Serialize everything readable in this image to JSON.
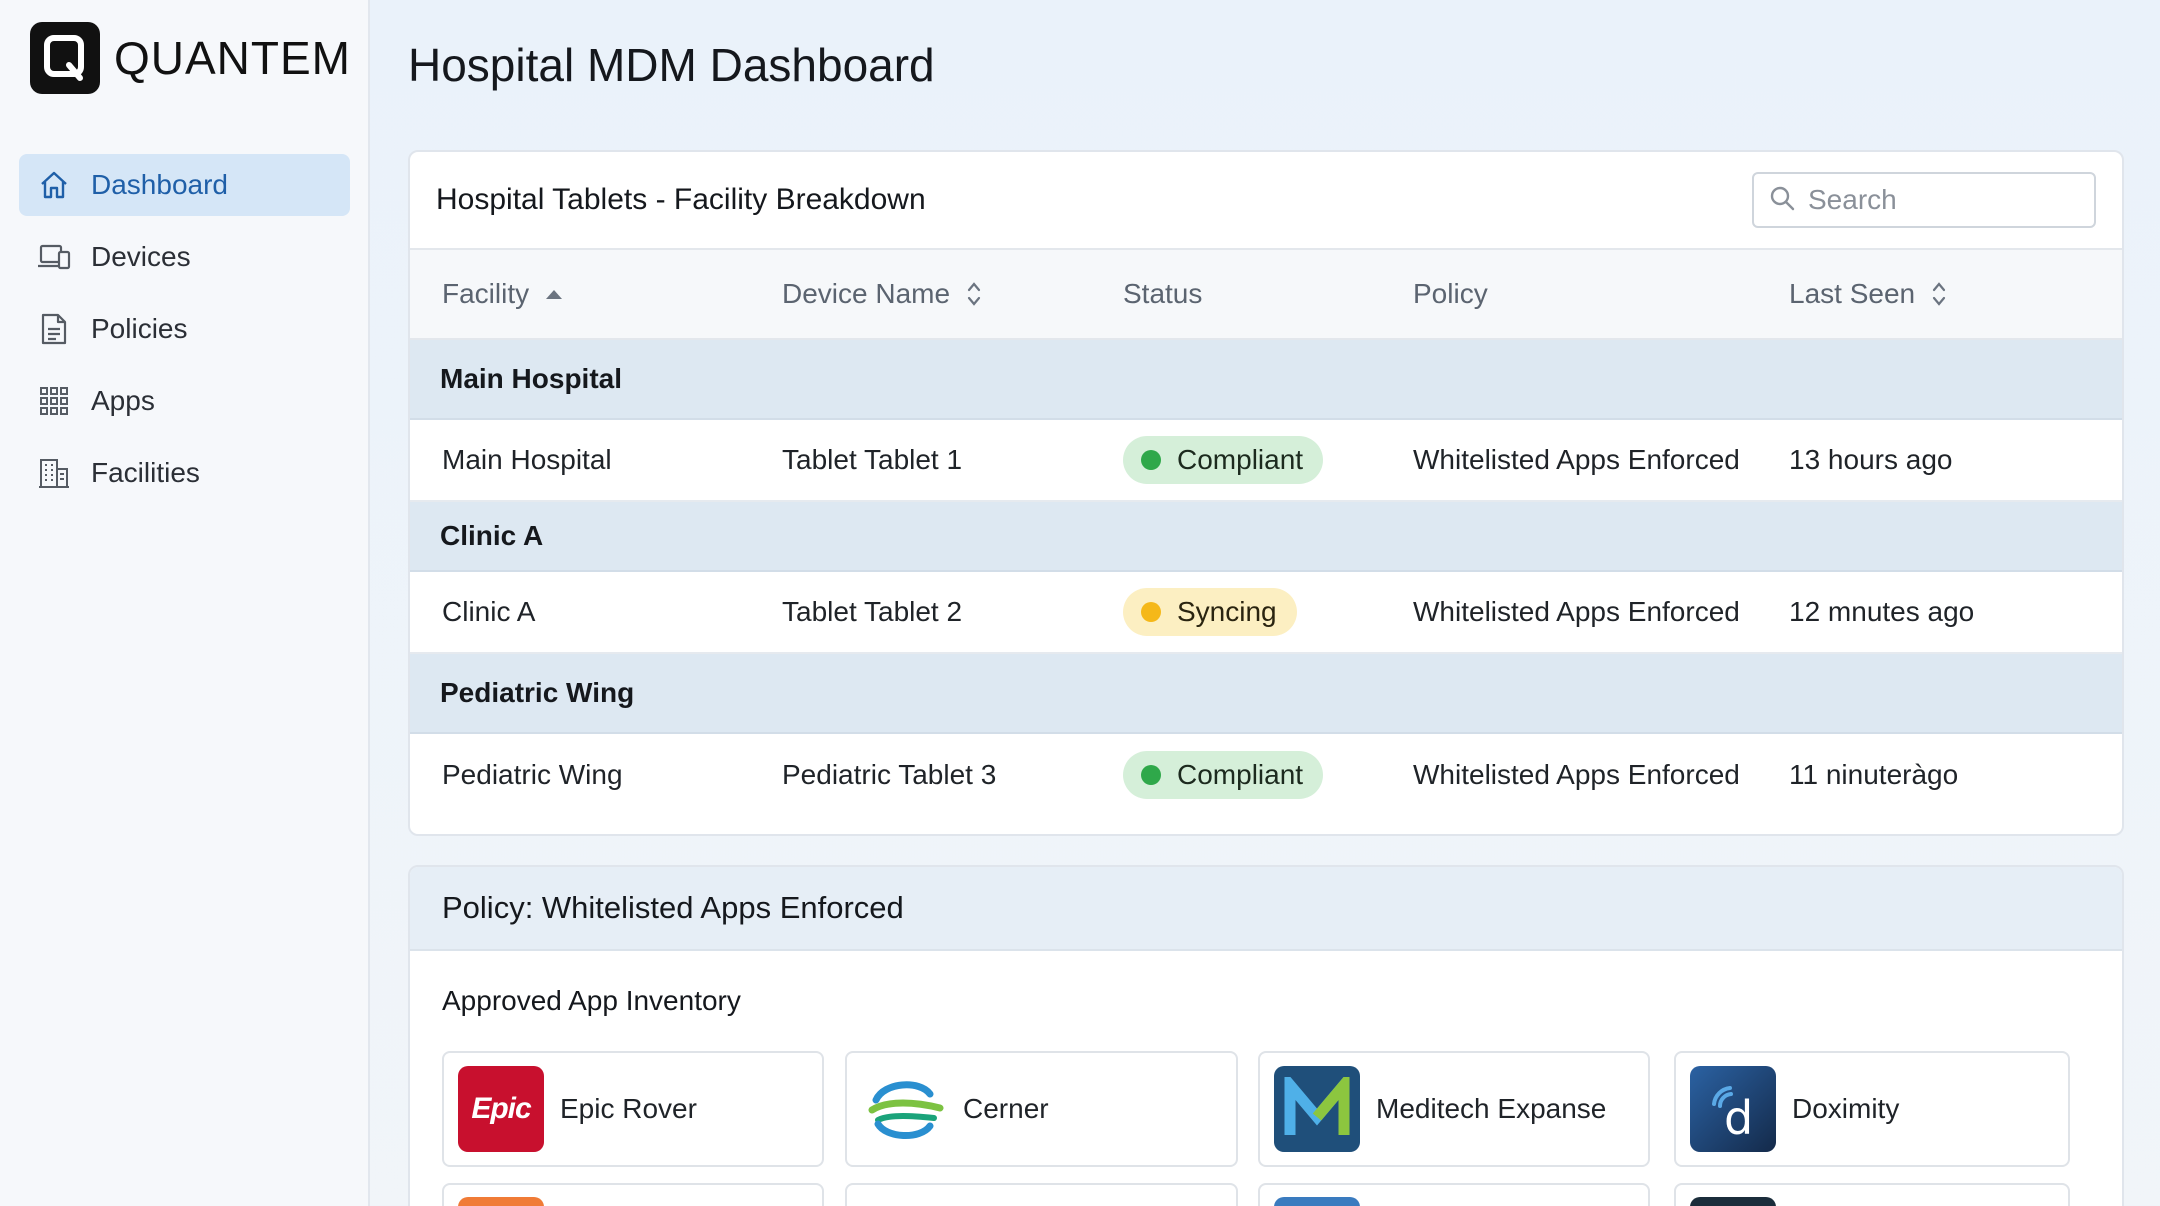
{
  "brand": {
    "name": "QUANTEM",
    "logo_letter": "Q"
  },
  "sidebar": {
    "items": [
      {
        "label": "Dashboard",
        "icon": "home-icon",
        "active": true
      },
      {
        "label": "Devices",
        "icon": "devices-icon"
      },
      {
        "label": "Policies",
        "icon": "document-icon"
      },
      {
        "label": "Apps",
        "icon": "grid-icon"
      },
      {
        "label": "Facilities",
        "icon": "building-icon"
      }
    ]
  },
  "page": {
    "title": "Hospital MDM Dashboard"
  },
  "tablets_card": {
    "title": "Hospital Tablets - Facility Breakdown",
    "search_placeholder": "Search",
    "columns": {
      "facility": "Facility",
      "device": "Device Name",
      "status": "Status",
      "policy": "Policy",
      "last_seen": "Last Seen"
    },
    "groups": [
      {
        "name": "Main Hospital",
        "rows": [
          {
            "facility": "Main Hospital",
            "device": "Tablet Tablet 1",
            "status": "Compliant",
            "status_color": "#2fa84a",
            "policy": "Whitelisted Apps Enforced",
            "last_seen": "13 hours ago"
          }
        ]
      },
      {
        "name": "Clinic A",
        "rows": [
          {
            "facility": "Clinic A",
            "device": "Tablet Tablet 2",
            "status": "Syncing",
            "status_color": "#f5b819",
            "policy": "Whitelisted Apps Enforced",
            "last_seen": "12 mnutes ago"
          }
        ]
      },
      {
        "name": "Pediatric Wing",
        "rows": [
          {
            "facility": "Pediatric Wing",
            "device": "Pediatric Tablet 3",
            "status": "Compliant",
            "status_color": "#2fa84a",
            "policy": "Whitelisted Apps Enforced",
            "last_seen": "11 ninuteràgo"
          }
        ]
      }
    ]
  },
  "policy_card": {
    "title": "Policy: Whitelisted Apps Enforced",
    "subtitle": "Approved App Inventory",
    "apps": [
      {
        "name": "Epic Rover",
        "icon": "epic-logo-icon",
        "icon_text": "Epic",
        "color": "#c8102e"
      },
      {
        "name": "Cerner",
        "icon": "cerner-logo-icon",
        "color": "#2a8fd0"
      },
      {
        "name": "Meditech Expanse",
        "icon": "meditech-logo-icon",
        "icon_text": "M",
        "color": "#1f4f7a"
      },
      {
        "name": "Doximity",
        "icon": "doximity-logo-icon",
        "icon_text": "d",
        "color": "#1d3f66"
      }
    ]
  }
}
